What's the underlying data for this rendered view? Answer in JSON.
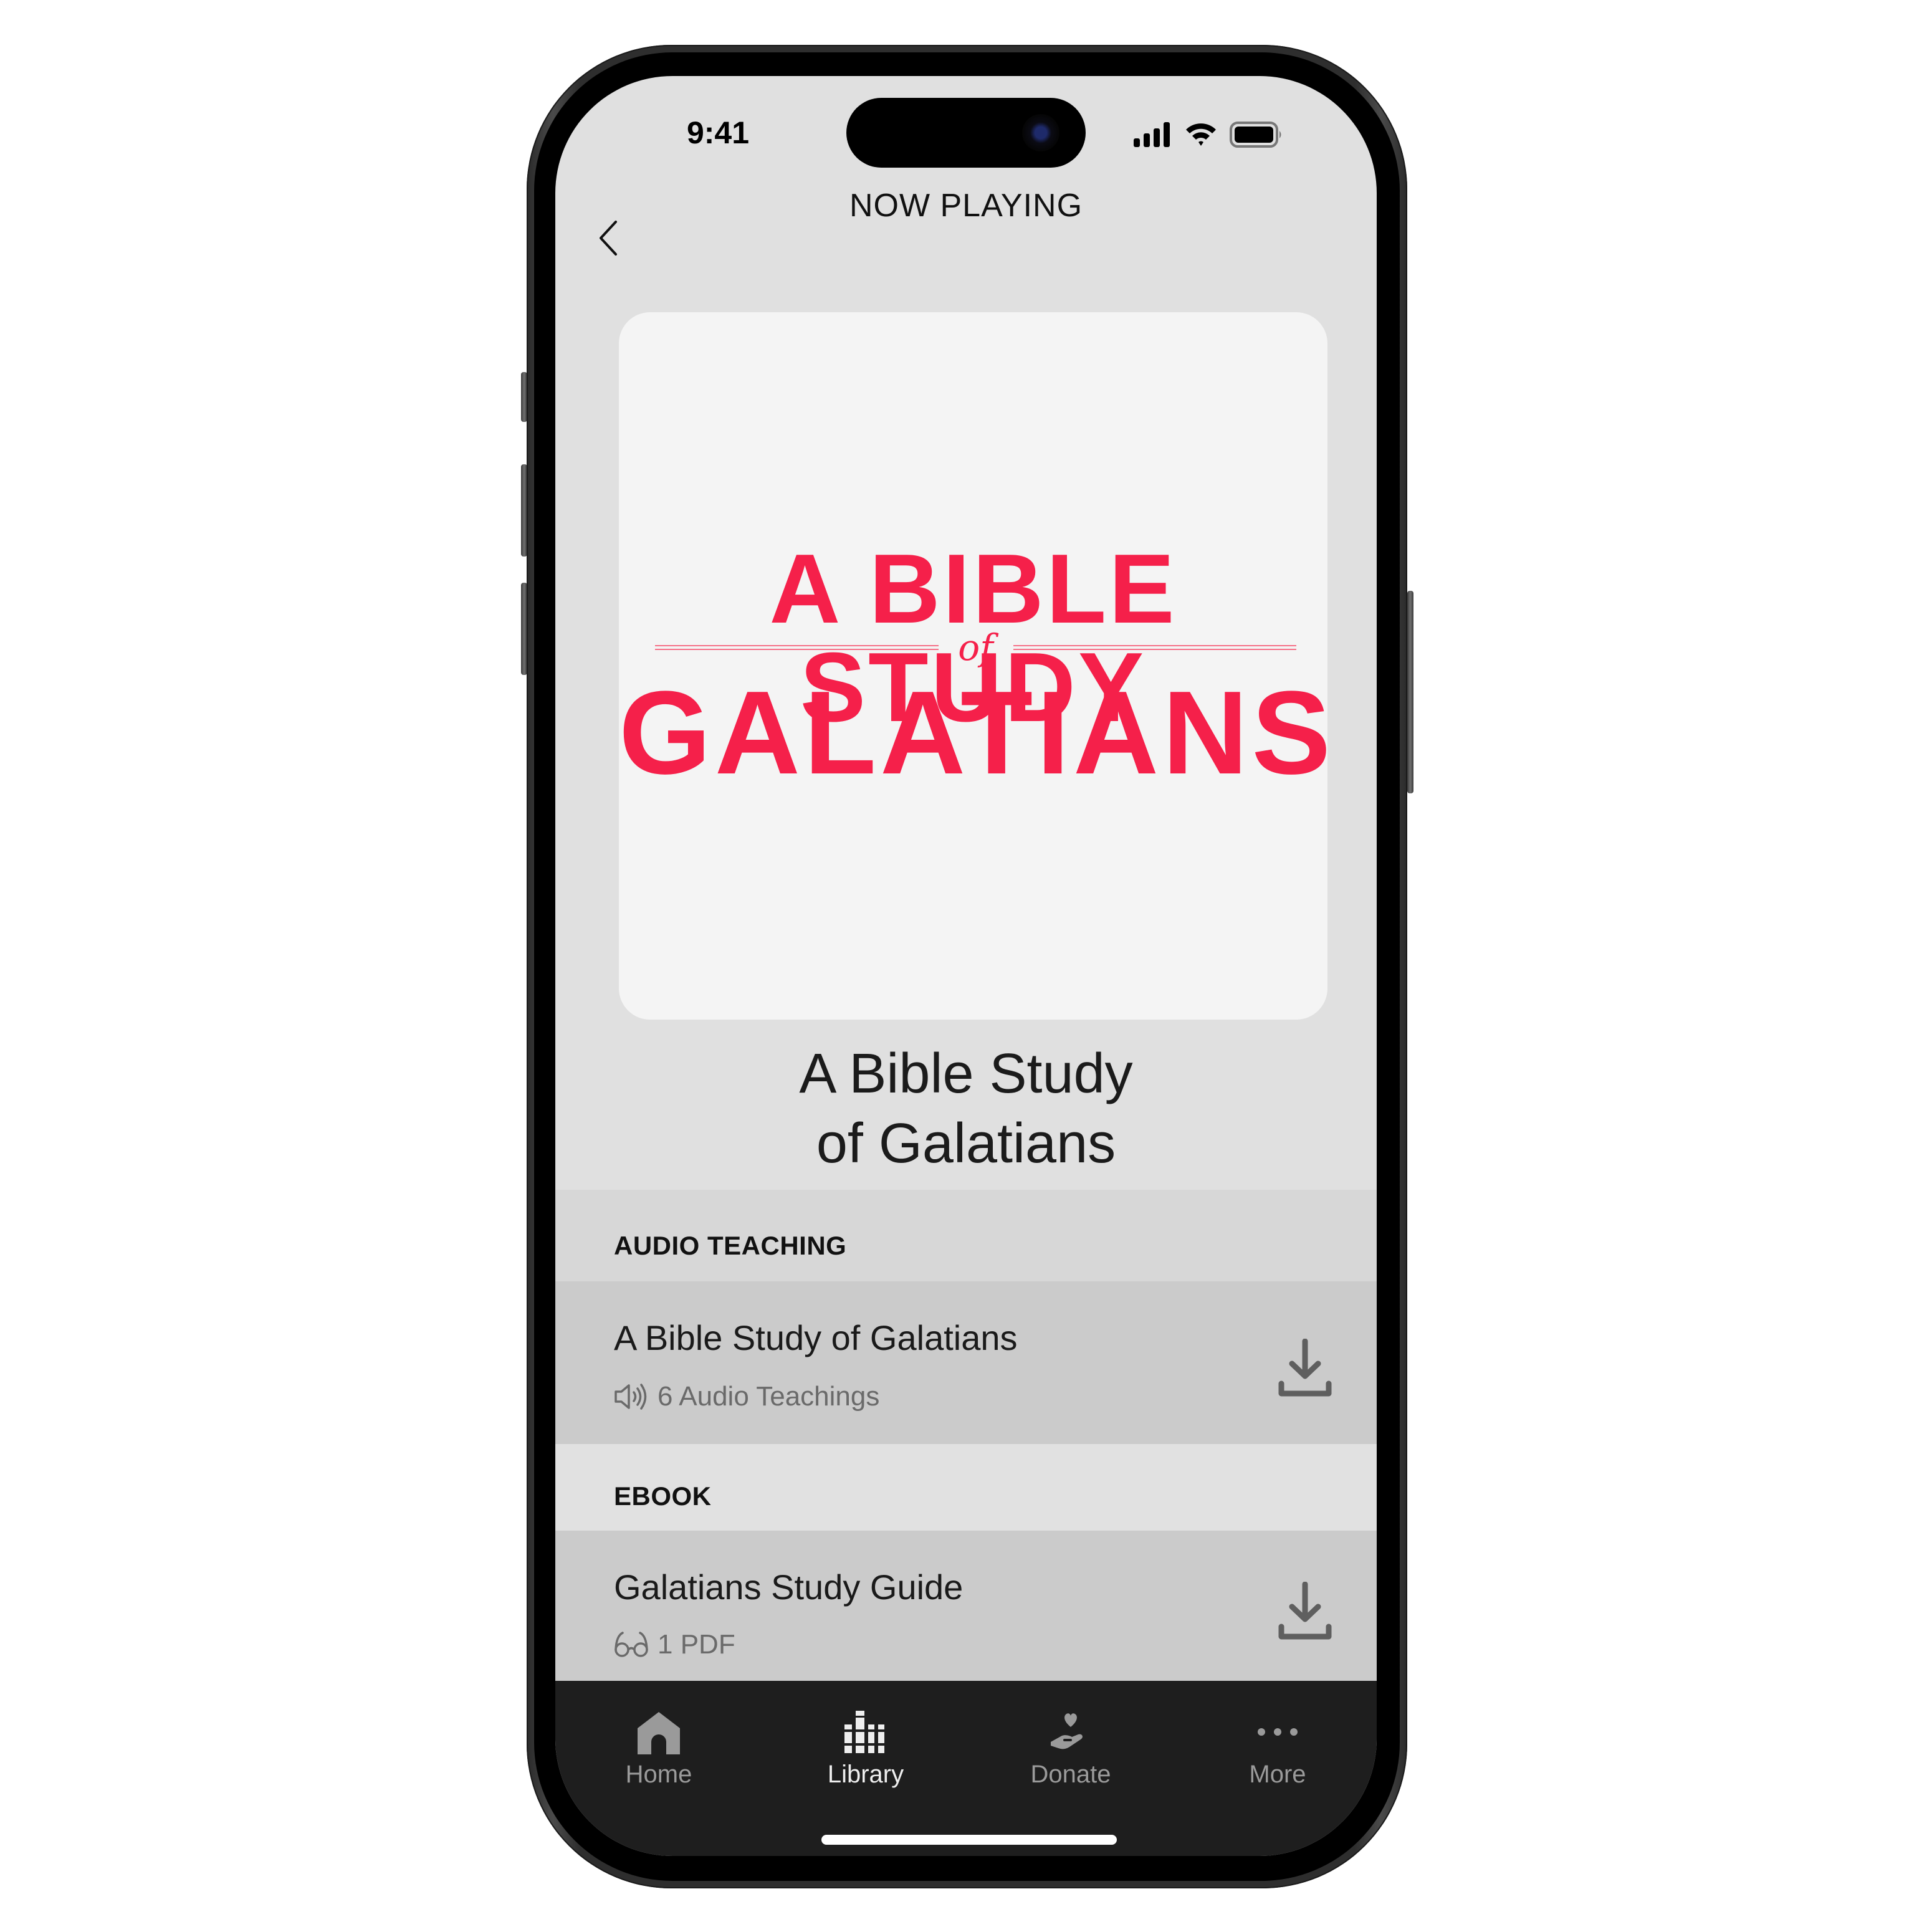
{
  "status_bar": {
    "time": "9:41",
    "icons": [
      "cellular-signal-icon",
      "wifi-icon",
      "battery-icon"
    ]
  },
  "nav": {
    "title": "NOW PLAYING",
    "back_icon": "chevron-left-icon"
  },
  "artwork": {
    "line1": "A BIBLE STUDY",
    "connector": "of",
    "line2": "GALATIANS",
    "accent_color": "#f5204a",
    "background": "#f4f4f4"
  },
  "title": {
    "line1": "A Bible Study",
    "line2": "of Galatians"
  },
  "sections": [
    {
      "header": "AUDIO TEACHING",
      "items": [
        {
          "title": "A Bible Study of Galatians",
          "meta_icon": "speaker-icon",
          "meta": "6 Audio Teachings",
          "action_icon": "download-icon"
        }
      ]
    },
    {
      "header": "EBOOK",
      "items": [
        {
          "title": "Galatians Study Guide",
          "meta_icon": "glasses-icon",
          "meta": "1 PDF",
          "action_icon": "download-icon"
        }
      ]
    }
  ],
  "tabbar": {
    "active": "Library",
    "active_color": "#eeeeee",
    "inactive_color": "#9a9a9a",
    "items": [
      {
        "label": "Home",
        "icon": "home-icon"
      },
      {
        "label": "Library",
        "icon": "library-icon"
      },
      {
        "label": "Donate",
        "icon": "donate-icon"
      },
      {
        "label": "More",
        "icon": "more-icon"
      }
    ]
  }
}
